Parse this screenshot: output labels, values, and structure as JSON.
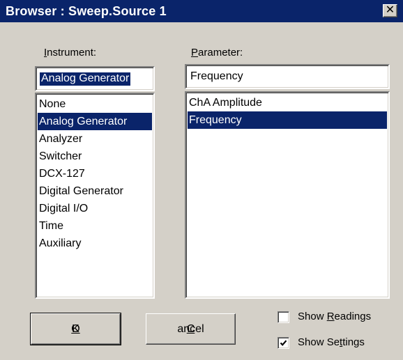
{
  "window": {
    "title": "Browser : Sweep.Source 1",
    "close_glyph": "✕"
  },
  "instrument": {
    "label_hotkey": "I",
    "label_rest": "nstrument:",
    "value": "Analog Generator",
    "items": [
      "None",
      "Analog Generator",
      "Analyzer",
      "Switcher",
      "DCX-127",
      "Digital Generator",
      "Digital I/O",
      "Time",
      "Auxiliary"
    ],
    "selected_index": 1
  },
  "parameter": {
    "label_hotkey": "P",
    "label_rest": "arameter:",
    "value": "Frequency",
    "items": [
      "ChA Amplitude",
      "Frequency"
    ],
    "selected_index": 1
  },
  "buttons": {
    "ok_hotkey": "O",
    "ok_rest": "K",
    "cancel_hotkey": "C",
    "cancel_rest": "ancel"
  },
  "checkboxes": {
    "show_readings_pre": "Show ",
    "show_readings_hotkey": "R",
    "show_readings_post": "eadings",
    "show_readings_checked": false,
    "show_settings_pre": "Show Se",
    "show_settings_hotkey": "t",
    "show_settings_post": "tings",
    "show_settings_checked": true
  },
  "colors": {
    "titlebar": "#0a246a",
    "selection": "#0a246a",
    "face": "#d4d0c8"
  }
}
